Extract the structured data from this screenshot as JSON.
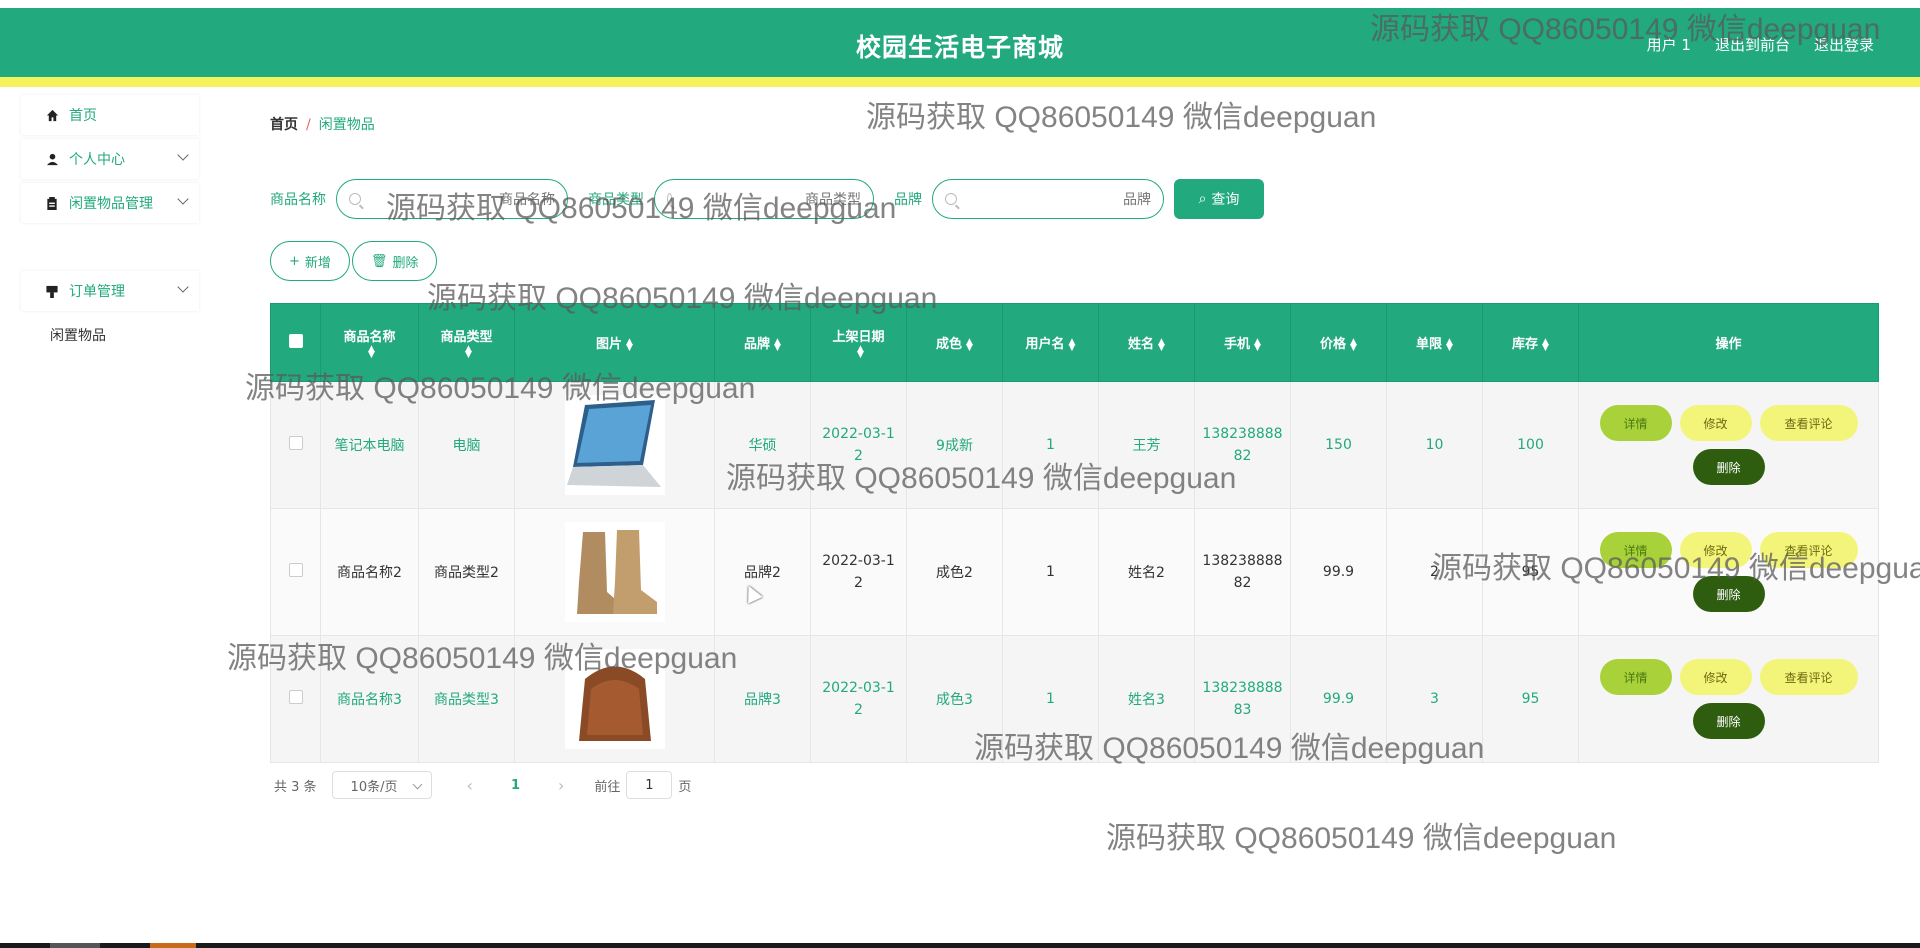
{
  "header": {
    "title": "校园生活电子商城",
    "user_label": "用户 1",
    "front_label": "退出到前台",
    "logout_label": "退出登录",
    "color": "#22a97e"
  },
  "sidebar": {
    "items": [
      {
        "label": "首页",
        "icon": "home-icon"
      },
      {
        "label": "个人中心",
        "icon": "user-icon"
      },
      {
        "label": "闲置物品管理",
        "icon": "clipboard-icon"
      },
      {
        "label": "订单管理",
        "icon": "order-icon"
      }
    ],
    "sub_item": "闲置物品"
  },
  "breadcrumb": {
    "home": "首页",
    "sep": "/",
    "current": "闲置物品"
  },
  "search": {
    "name_label": "商品名称",
    "name_placeholder": "商品名称",
    "type_label": "商品类型",
    "type_placeholder": "商品类型",
    "brand_label": "品牌",
    "brand_placeholder": "品牌",
    "query_label": "查询"
  },
  "actions": {
    "add_label": "新增",
    "delete_label": "删除"
  },
  "table": {
    "headers": [
      "商品名称",
      "商品类型",
      "图片",
      "品牌",
      "上架日期",
      "成色",
      "用户名",
      "姓名",
      "手机",
      "价格",
      "单限",
      "库存",
      "操作"
    ],
    "rows": [
      {
        "name": "笔记本电脑",
        "type": "电脑",
        "image": "laptop",
        "brand": "华硕",
        "date": "2022-03-12",
        "condition": "9成新",
        "username": "1",
        "realname": "王芳",
        "phone": "13823888882",
        "price": "150",
        "limit": "10",
        "stock": "100"
      },
      {
        "name": "商品名称2",
        "type": "商品类型2",
        "image": "boots",
        "brand": "品牌2",
        "date": "2022-03-12",
        "condition": "成色2",
        "username": "1",
        "realname": "姓名2",
        "phone": "13823888882",
        "price": "99.9",
        "limit": "2",
        "stock": "95"
      },
      {
        "name": "商品名称3",
        "type": "商品类型3",
        "image": "bag",
        "brand": "品牌3",
        "date": "2022-03-12",
        "condition": "成色3",
        "username": "1",
        "realname": "姓名3",
        "phone": "13823888883",
        "price": "99.9",
        "limit": "3",
        "stock": "95"
      }
    ],
    "op_labels": {
      "detail": "详情",
      "edit": "修改",
      "review": "查看评论",
      "delete": "删除"
    }
  },
  "pager": {
    "total": "共 3 条",
    "page_size": "10条/页",
    "current": "1",
    "goto_label": "前往",
    "goto_value": "1",
    "page_suffix": "页"
  },
  "watermark": "源码获取 QQ86050149 微信deepguan"
}
